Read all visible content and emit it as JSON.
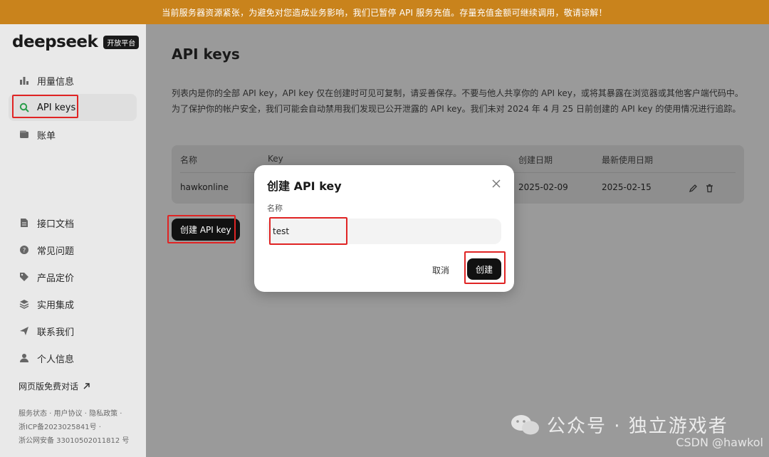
{
  "banner": {
    "text": "当前服务器资源紧张，为避免对您造成业务影响，我们已暂停 API 服务充值。存量充值金额可继续调用，敬请谅解！"
  },
  "sidebar": {
    "logo": {
      "name": "deepseek",
      "badge": "开放平台"
    },
    "top_items": [
      {
        "label": "用量信息",
        "icon": "bar-chart-icon"
      },
      {
        "label": "API keys",
        "icon": "search-icon",
        "active": true
      },
      {
        "label": "账单",
        "icon": "wallet-icon"
      }
    ],
    "bottom_items": [
      {
        "label": "接口文档",
        "icon": "document-icon"
      },
      {
        "label": "常见问题",
        "icon": "question-icon"
      },
      {
        "label": "产品定价",
        "icon": "tag-icon"
      },
      {
        "label": "实用集成",
        "icon": "layers-icon"
      },
      {
        "label": "联系我们",
        "icon": "send-icon"
      },
      {
        "label": "个人信息",
        "icon": "user-icon"
      }
    ],
    "web_chat": "网页版免费对话",
    "footer": {
      "links": "服务状态 · 用户协议 · 隐私政策 ·",
      "icp": "浙ICP备2023025841号 ·",
      "police": "浙公网安备 33010502011812 号"
    }
  },
  "main": {
    "title": "API keys",
    "description": "列表内是你的全部 API key，API key 仅在创建时可见可复制，请妥善保存。不要与他人共享你的 API key，或将其暴露在浏览器或其他客户端代码中。为了保护你的帐户安全，我们可能会自动禁用我们发现已公开泄露的 API key。我们未对 2024 年 4 月 25 日前创建的 API key 的使用情况进行追踪。",
    "table": {
      "headers": {
        "name": "名称",
        "key": "Key",
        "created": "创建日期",
        "last_used": "最新使用日期"
      },
      "rows": [
        {
          "name": "hawkonline",
          "created": "2025-02-09",
          "last_used": "2025-02-15"
        }
      ]
    },
    "create_button": "创建 API key"
  },
  "modal": {
    "title": "创建 API key",
    "field_label": "名称",
    "input_value": "test",
    "cancel": "取消",
    "confirm": "创建"
  },
  "watermark": {
    "text": "公众号 · 独立游戏者",
    "csdn": "CSDN @hawkol"
  },
  "colors": {
    "banner": "#c9831c",
    "accent_green": "#2a9d4a",
    "highlight_red": "#e02424",
    "button_black": "#111111"
  }
}
